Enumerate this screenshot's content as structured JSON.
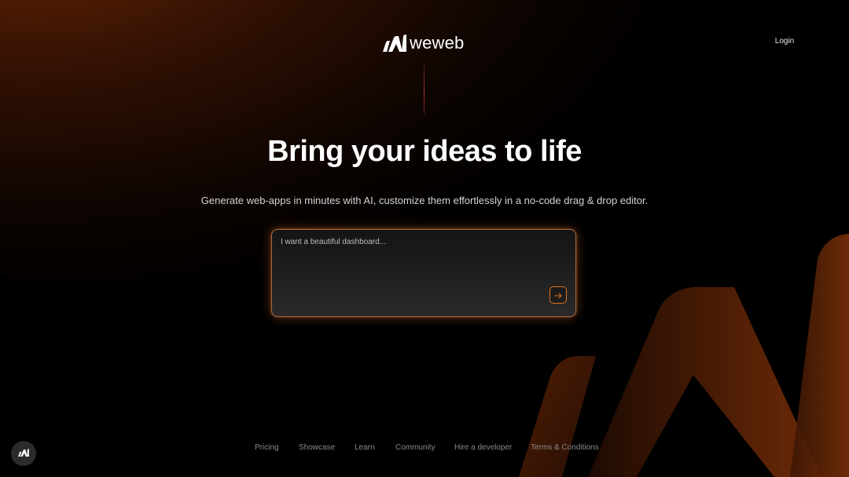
{
  "header": {
    "brand_name": "weweb",
    "login_label": "Login"
  },
  "hero": {
    "title": "Bring your ideas to life",
    "subtitle": "Generate web-apps in minutes with AI, customize them effortlessly in a no-code drag & drop editor."
  },
  "prompt": {
    "placeholder": "I want a beautiful dashboard...",
    "value": "",
    "submit_icon": "arrow-right-icon"
  },
  "footer": {
    "links": [
      {
        "label": "Pricing"
      },
      {
        "label": "Showcase"
      },
      {
        "label": "Learn"
      },
      {
        "label": "Community"
      },
      {
        "label": "Hire a developer"
      },
      {
        "label": "Terms & Conditions"
      }
    ]
  },
  "icons": {
    "brand": "weweb-logo-icon",
    "fab": "weweb-logo-icon"
  },
  "colors": {
    "background": "#000000",
    "accent": "#e0741f",
    "glow": "#822d08",
    "text": "#ffffff",
    "muted_text": "#8a8a8a"
  }
}
